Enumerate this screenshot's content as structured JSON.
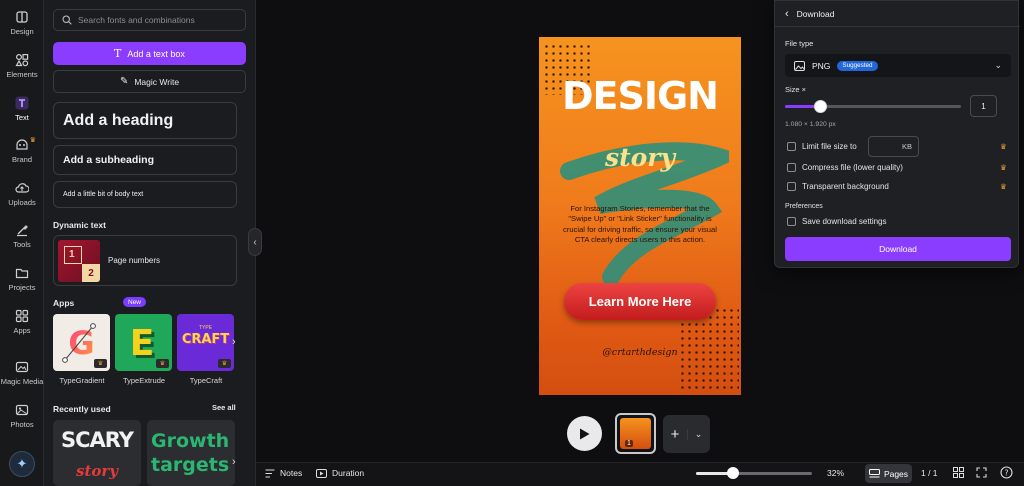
{
  "rail": {
    "items": [
      {
        "label": "Design",
        "icon": "design-icon"
      },
      {
        "label": "Elements",
        "icon": "elements-icon"
      },
      {
        "label": "Text",
        "icon": "text-icon"
      },
      {
        "label": "Brand",
        "icon": "brand-icon"
      },
      {
        "label": "Uploads",
        "icon": "uploads-icon"
      },
      {
        "label": "Tools",
        "icon": "tools-icon"
      },
      {
        "label": "Projects",
        "icon": "projects-icon"
      },
      {
        "label": "Apps",
        "icon": "apps-icon"
      },
      {
        "label": "Magic Media",
        "icon": "magic-media-icon"
      },
      {
        "label": "Photos",
        "icon": "photos-icon"
      }
    ],
    "active": "Text"
  },
  "panel": {
    "search_placeholder": "Search fonts and combinations",
    "add_text_label": "Add a text box",
    "magic_write_label": "Magic Write",
    "heading_label": "Add a heading",
    "subheading_label": "Add a subheading",
    "body_label": "Add a little bit of body text",
    "dynamic_text_title": "Dynamic text",
    "page_numbers_label": "Page numbers",
    "page_numbers_thumb": {
      "n1": "1",
      "n2": "2"
    },
    "apps_title": "Apps",
    "apps_badge": "New",
    "apps": [
      {
        "name": "TypeGradient",
        "tile_text": "G"
      },
      {
        "name": "TypeExtrude",
        "tile_text": "E"
      },
      {
        "name": "TypeCraft",
        "tile_text": "CRAFT",
        "tile_small": "TYPE"
      }
    ],
    "recent_title": "Recently used",
    "see_all": "See all",
    "recent": [
      {
        "text1": "SCARY",
        "text2": "story"
      },
      {
        "text1": "Growth",
        "text2": "targets"
      }
    ]
  },
  "design": {
    "title": "DESIGN",
    "story": "story",
    "body": "For Instagram Stories, remember that the \"Swipe Up\" or \"Link Sticker\" functionality is crucial for driving traffic, so ensure your visual CTA clearly directs users to this action.",
    "button": "Learn More Here",
    "handle": "@crtarthdesign"
  },
  "playback": {
    "page_label": "1"
  },
  "bottombar": {
    "notes": "Notes",
    "duration": "Duration",
    "zoom": "32%",
    "zoom_fraction": 0.32,
    "pages": "Pages",
    "page_count": "1 / 1"
  },
  "download": {
    "title": "Download",
    "file_type_label": "File type",
    "file_type": "PNG",
    "suggested": "Suggested",
    "size_label": "Size ×",
    "size_value": "1",
    "size_fraction": 0.2,
    "dimensions": "1.080 × 1.920 px",
    "limit_label": "Limit file size to",
    "kb_unit": "KB",
    "compress_label": "Compress file (lower quality)",
    "transparent_label": "Transparent background",
    "preferences_label": "Preferences",
    "save_settings_label": "Save download settings",
    "button": "Download"
  },
  "colors": {
    "accent": "#8b3dff",
    "canvas_orange": "#f07c1c",
    "cta_red": "#d92b2b",
    "crown": "#f2a33a"
  }
}
